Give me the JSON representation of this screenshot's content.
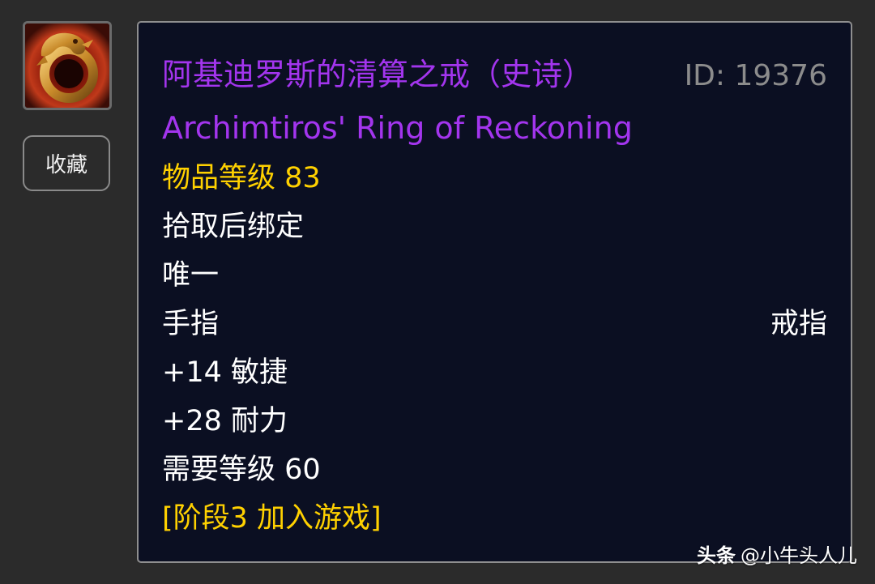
{
  "left": {
    "icon_name": "golden-dragon-ring-icon",
    "fav_button_label": "收藏"
  },
  "tooltip": {
    "title_cn": "阿基迪罗斯的清算之戒（史诗）",
    "item_id": "ID: 19376",
    "title_en": "Archimtiros' Ring of Reckoning",
    "item_level": "物品等级 83",
    "binding": "拾取后绑定",
    "unique": "唯一",
    "slot": "手指",
    "slot_type": "戒指",
    "stat_agility": "+14 敏捷",
    "stat_stamina": "+28 耐力",
    "required_level": "需要等级 60",
    "phase": "[阶段3 加入游戏]"
  },
  "watermark": {
    "brand": "头条",
    "author": "@小牛头人儿"
  },
  "colors": {
    "epic": "#a335ee",
    "gold": "#ffd100",
    "id_gray": "#8c8c8c",
    "panel_bg": "#0b0f22",
    "page_bg": "#2b2b2b"
  }
}
